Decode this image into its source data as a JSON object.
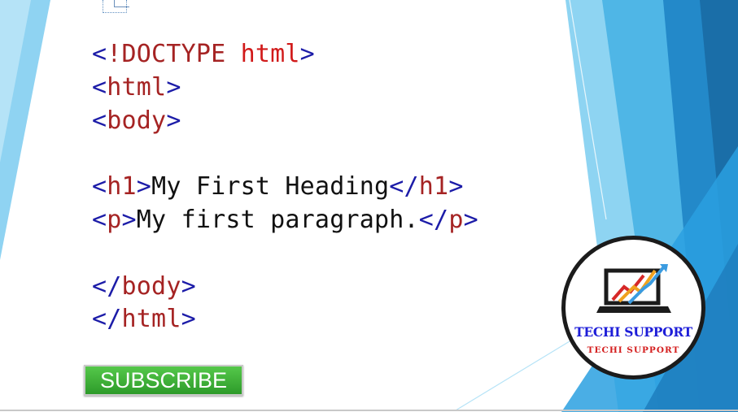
{
  "code_lines": [
    {
      "parts": [
        {
          "text": "<",
          "cls": "blue"
        },
        {
          "text": "!DOCTYPE",
          "cls": "tag"
        },
        {
          "text": " html",
          "cls": "red"
        },
        {
          "text": ">",
          "cls": "blue"
        }
      ]
    },
    {
      "parts": [
        {
          "text": "<",
          "cls": "blue"
        },
        {
          "text": "html",
          "cls": "tag"
        },
        {
          "text": ">",
          "cls": "blue"
        }
      ]
    },
    {
      "parts": [
        {
          "text": "<",
          "cls": "blue"
        },
        {
          "text": "body",
          "cls": "tag"
        },
        {
          "text": ">",
          "cls": "blue"
        }
      ]
    },
    {
      "parts": []
    },
    {
      "parts": [
        {
          "text": "<",
          "cls": "blue"
        },
        {
          "text": "h1",
          "cls": "tag"
        },
        {
          "text": ">",
          "cls": "blue"
        },
        {
          "text": "My First Heading",
          "cls": "txt"
        },
        {
          "text": "</",
          "cls": "blue"
        },
        {
          "text": "h1",
          "cls": "tag"
        },
        {
          "text": ">",
          "cls": "blue"
        }
      ]
    },
    {
      "parts": [
        {
          "text": "<",
          "cls": "blue"
        },
        {
          "text": "p",
          "cls": "tag"
        },
        {
          "text": ">",
          "cls": "blue"
        },
        {
          "text": "My first paragraph.",
          "cls": "txt"
        },
        {
          "text": "</",
          "cls": "blue"
        },
        {
          "text": "p",
          "cls": "tag"
        },
        {
          "text": ">",
          "cls": "blue"
        }
      ]
    },
    {
      "parts": []
    },
    {
      "parts": [
        {
          "text": "</",
          "cls": "blue"
        },
        {
          "text": "body",
          "cls": "tag"
        },
        {
          "text": ">",
          "cls": "blue"
        }
      ]
    },
    {
      "parts": [
        {
          "text": "</",
          "cls": "blue"
        },
        {
          "text": "html",
          "cls": "tag"
        },
        {
          "text": ">",
          "cls": "blue"
        }
      ]
    }
  ],
  "subscribe": {
    "label": "SUBSCRIBE"
  },
  "logo": {
    "title": "TECHI SUPPORT",
    "subtitle": "TECHI SUPPORT"
  },
  "colors": {
    "syntax_blue": "#1c1ca8",
    "syntax_red": "#d11a1a",
    "syntax_tag": "#a52323",
    "subscribe_green": "#3db336",
    "background_blue": "#2aa0e0"
  },
  "icons": [
    "laptop-chart-icon"
  ]
}
